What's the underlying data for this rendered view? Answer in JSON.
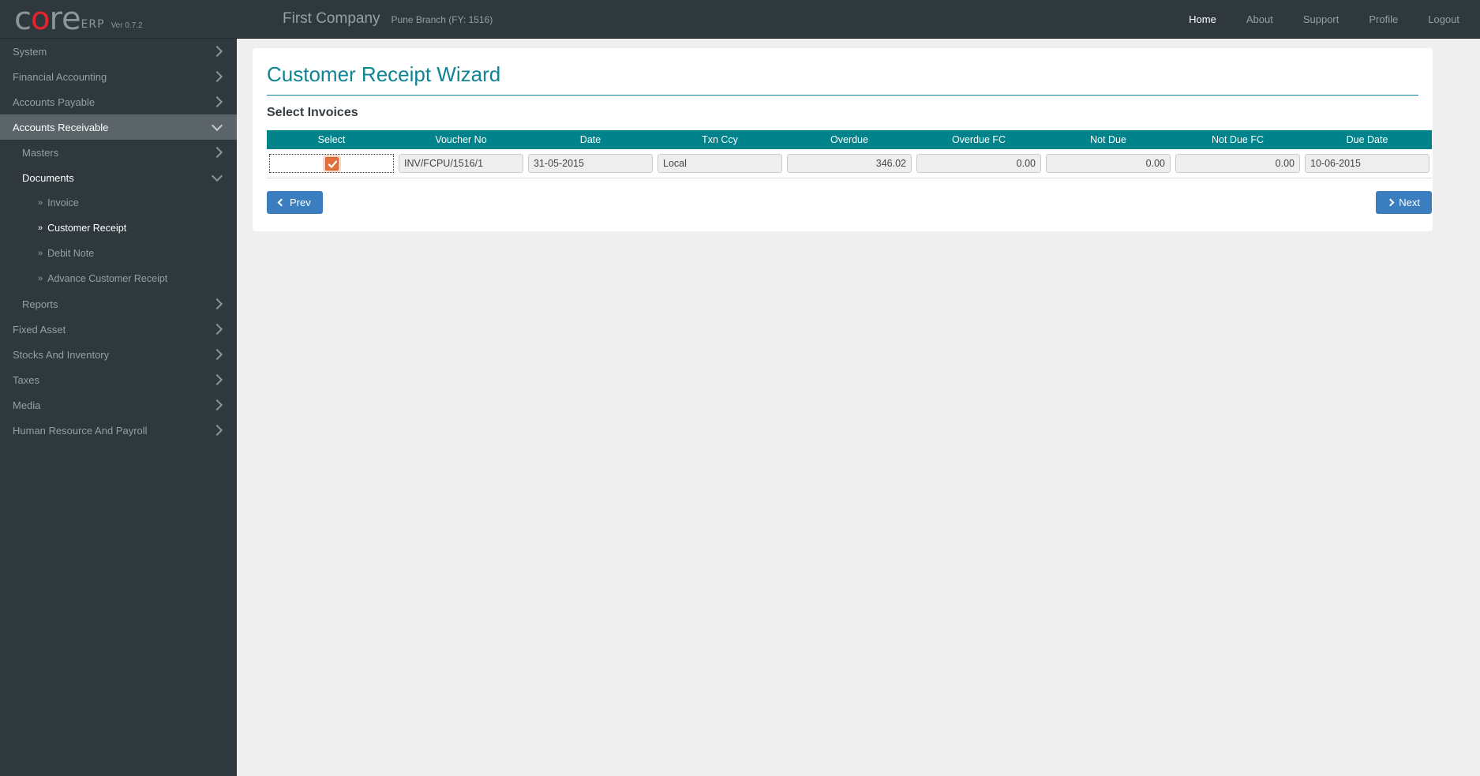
{
  "topbar": {
    "logo": {
      "letters": [
        "c",
        "o",
        "r",
        "e"
      ],
      "red_letter_index": 1,
      "suffix": "ERP",
      "version": "Ver 0.7.2"
    },
    "company": "First Company",
    "branch": "Pune Branch (FY: 1516)",
    "nav": [
      {
        "label": "Home",
        "active": true
      },
      {
        "label": "About",
        "active": false
      },
      {
        "label": "Support",
        "active": false
      },
      {
        "label": "Profile",
        "active": false
      },
      {
        "label": "Logout",
        "active": false
      }
    ]
  },
  "sidebar": {
    "items": [
      {
        "label": "System",
        "level": 0,
        "icon": "chevron-right-icon"
      },
      {
        "label": "Financial Accounting",
        "level": 0,
        "icon": "chevron-right-icon"
      },
      {
        "label": "Accounts Payable",
        "level": 0,
        "icon": "chevron-right-icon"
      },
      {
        "label": "Accounts Receivable",
        "level": 0,
        "icon": "chevron-down-icon",
        "active": true
      },
      {
        "label": "Masters",
        "level": 1,
        "icon": "chevron-right-icon"
      },
      {
        "label": "Documents",
        "level": 1,
        "icon": "chevron-down-icon",
        "active": true
      },
      {
        "label": "Invoice",
        "level": 2,
        "bullet": "»"
      },
      {
        "label": "Customer Receipt",
        "level": 2,
        "bullet": "»",
        "active": true
      },
      {
        "label": "Debit Note",
        "level": 2,
        "bullet": "»"
      },
      {
        "label": "Advance Customer Receipt",
        "level": 2,
        "bullet": "»"
      },
      {
        "label": "Reports",
        "level": 1,
        "icon": "chevron-right-icon"
      },
      {
        "label": "Fixed Asset",
        "level": 0,
        "icon": "chevron-right-icon"
      },
      {
        "label": "Stocks And Inventory",
        "level": 0,
        "icon": "chevron-right-icon"
      },
      {
        "label": "Taxes",
        "level": 0,
        "icon": "chevron-right-icon"
      },
      {
        "label": "Media",
        "level": 0,
        "icon": "chevron-right-icon"
      },
      {
        "label": "Human Resource And Payroll",
        "level": 0,
        "icon": "chevron-right-icon"
      }
    ]
  },
  "page": {
    "title": "Customer Receipt Wizard",
    "section": "Select Invoices"
  },
  "table": {
    "columns": [
      "Select",
      "Voucher No",
      "Date",
      "Txn Ccy",
      "Overdue",
      "Overdue FC",
      "Not Due",
      "Not Due FC",
      "Due Date"
    ],
    "rows": [
      {
        "selected": true,
        "voucher_no": "INV/FCPU/1516/1",
        "date": "31-05-2015",
        "txn_ccy": "Local",
        "overdue": "346.02",
        "overdue_fc": "0.00",
        "not_due": "0.00",
        "not_due_fc": "0.00",
        "due_date": "10-06-2015"
      }
    ]
  },
  "buttons": {
    "prev": "Prev",
    "next": "Next"
  },
  "colors": {
    "topbar_bg": "#2e383d",
    "sidebar_bg": "#2e383d",
    "sidebar_active": "#5b6569",
    "teal": "#00838a",
    "title_teal": "#0e8494",
    "button_blue": "#3a7ebf",
    "checkbox_orange": "#e2703a",
    "page_bg": "#efefef"
  }
}
